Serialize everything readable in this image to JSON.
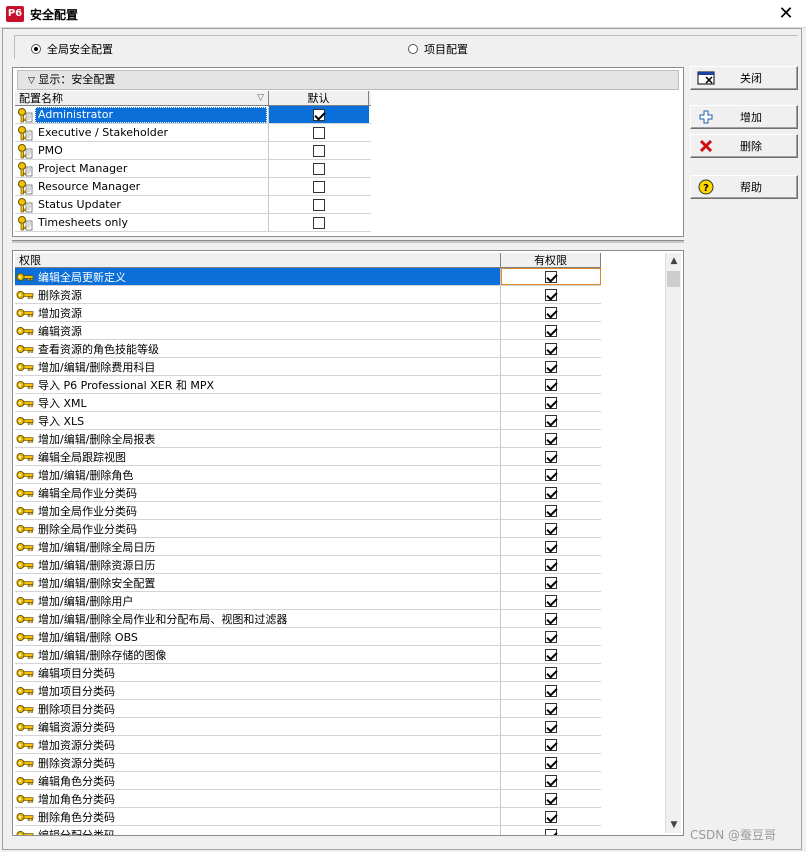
{
  "window": {
    "title": "安全配置",
    "app_badge": "P6"
  },
  "mode": {
    "global": "全局安全配置",
    "project": "项目配置",
    "selected": "global"
  },
  "display_label": "显示：安全配置",
  "profiles": {
    "col_name": "配置名称",
    "col_default": "默认",
    "rows": [
      {
        "name": "Administrator",
        "default": true,
        "selected": true
      },
      {
        "name": "Executive / Stakeholder",
        "default": false
      },
      {
        "name": "PMO",
        "default": false
      },
      {
        "name": "Project Manager",
        "default": false
      },
      {
        "name": "Resource Manager",
        "default": false
      },
      {
        "name": "Status Updater",
        "default": false
      },
      {
        "name": "Timesheets only",
        "default": false
      }
    ]
  },
  "buttons": {
    "close": "关闭",
    "add": "增加",
    "delete": "删除",
    "help": "帮助"
  },
  "permissions": {
    "col_name": "权限",
    "col_value": "有权限",
    "rows": [
      {
        "name": "编辑全局更新定义",
        "granted": true,
        "selected": true
      },
      {
        "name": "删除资源",
        "granted": true
      },
      {
        "name": "增加资源",
        "granted": true
      },
      {
        "name": "编辑资源",
        "granted": true
      },
      {
        "name": "查看资源的角色技能等级",
        "granted": true
      },
      {
        "name": "增加/编辑/删除费用科目",
        "granted": true
      },
      {
        "name": "导入 P6 Professional XER 和 MPX",
        "granted": true
      },
      {
        "name": "导入 XML",
        "granted": true
      },
      {
        "name": "导入 XLS",
        "granted": true
      },
      {
        "name": "增加/编辑/删除全局报表",
        "granted": true
      },
      {
        "name": "编辑全局跟踪视图",
        "granted": true
      },
      {
        "name": "增加/编辑/删除角色",
        "granted": true
      },
      {
        "name": "编辑全局作业分类码",
        "granted": true
      },
      {
        "name": "增加全局作业分类码",
        "granted": true
      },
      {
        "name": "删除全局作业分类码",
        "granted": true
      },
      {
        "name": "增加/编辑/删除全局日历",
        "granted": true
      },
      {
        "name": "增加/编辑/删除资源日历",
        "granted": true
      },
      {
        "name": "增加/编辑/删除安全配置",
        "granted": true
      },
      {
        "name": "增加/编辑/删除用户",
        "granted": true
      },
      {
        "name": "增加/编辑/删除全局作业和分配布局、视图和过滤器",
        "granted": true
      },
      {
        "name": "增加/编辑/删除 OBS",
        "granted": true
      },
      {
        "name": "增加/编辑/删除存储的图像",
        "granted": true
      },
      {
        "name": "编辑项目分类码",
        "granted": true
      },
      {
        "name": "增加项目分类码",
        "granted": true
      },
      {
        "name": "删除项目分类码",
        "granted": true
      },
      {
        "name": "编辑资源分类码",
        "granted": true
      },
      {
        "name": "增加资源分类码",
        "granted": true
      },
      {
        "name": "删除资源分类码",
        "granted": true
      },
      {
        "name": "编辑角色分类码",
        "granted": true
      },
      {
        "name": "增加角色分类码",
        "granted": true
      },
      {
        "name": "删除角色分类码",
        "granted": true
      },
      {
        "name": "编辑分配分类码",
        "granted": true
      }
    ]
  },
  "watermark": "CSDN @蚕豆哥",
  "colors": {
    "selection": "#0a6fd8",
    "badge": "#c8102e",
    "key": "#d9a800"
  }
}
